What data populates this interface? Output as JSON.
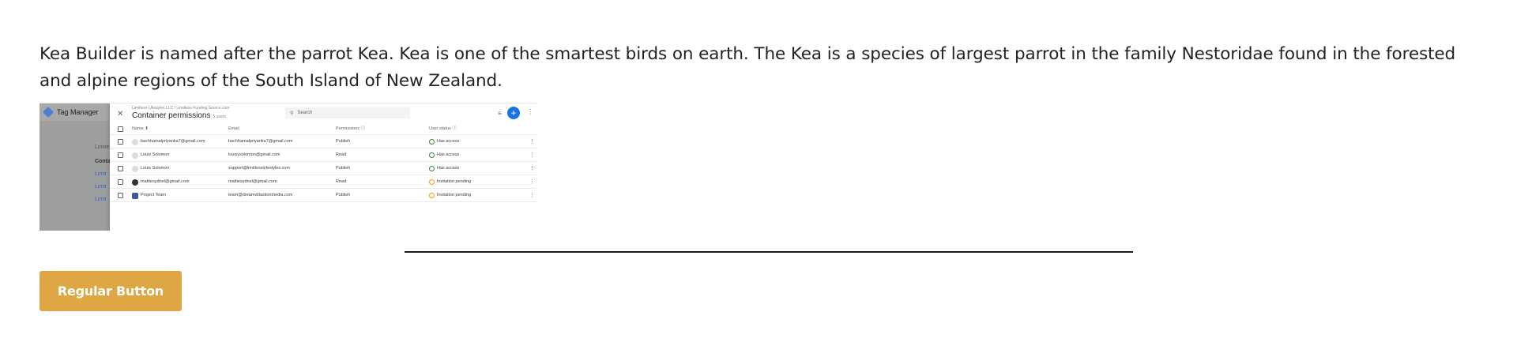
{
  "intro_text": "Kea Builder is named after the parrot Kea. Kea is one of the smartest birds on earth. The Kea is a species of largest parrot in the family Nestoridae found in the forested and alpine regions of the South Island of New Zealand.",
  "screenshot": {
    "app_name": "Tag Manager",
    "behind_labels": [
      "Limite",
      "Conta",
      "Limit",
      "Limit",
      "Limit"
    ],
    "breadcrumb": "Limitless Lifestyles LLC / Limitless Funding Source.com",
    "title": "Container permissions",
    "title_sub": "5 users",
    "search_placeholder": "Search",
    "add_label": "+",
    "columns": {
      "name": "Name ⬆",
      "email": "Email",
      "permissions": "Permissions ⓘ",
      "status": "User status ⓘ"
    },
    "rows": [
      {
        "name": "bachhamalpriyanka7@gmail.com",
        "email": "bachhamalpriyanka7@gmail.com",
        "permission": "Publish",
        "status": "Has access",
        "avatar": "generic",
        "pending": false
      },
      {
        "name": "Louis Solomon",
        "email": "louisysolomon@gmail.com",
        "permission": "Read",
        "status": "Has access",
        "avatar": "generic",
        "pending": false
      },
      {
        "name": "Louis Solomon",
        "email": "support@limitlesslyfestyles.com",
        "permission": "Publish",
        "status": "Has access",
        "avatar": "generic",
        "pending": false
      },
      {
        "name": "mattiesydnel@gmail.com",
        "email": "mattiesydnel@gmail.com",
        "permission": "Read",
        "status": "Invitation pending",
        "avatar": "person",
        "pending": true
      },
      {
        "name": "Project Team",
        "email": "team@dreamvillastionmedia.com",
        "permission": "Publish",
        "status": "Invitation pending",
        "avatar": "team",
        "pending": true
      }
    ]
  },
  "button_label": "Regular Button",
  "colors": {
    "button": "#dfa744",
    "accent_blue": "#1a73e8",
    "status_ok": "#1e8e3e",
    "status_pending": "#f29900"
  }
}
